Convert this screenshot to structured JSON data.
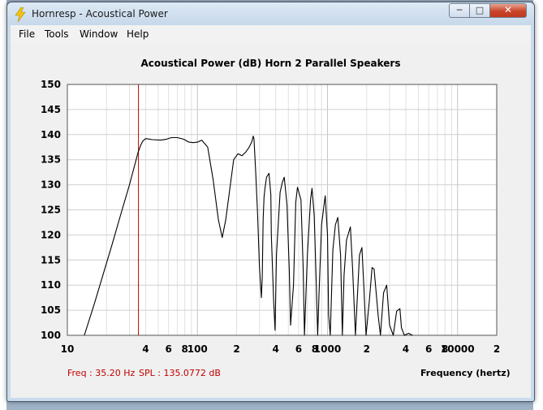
{
  "window": {
    "title": "Hornresp - Acoustical Power",
    "controls": {
      "minimize": "─",
      "maximize": "□",
      "close": "✕"
    }
  },
  "menu": [
    "File",
    "Tools",
    "Window",
    "Help"
  ],
  "chart_data": {
    "type": "line",
    "title": "Acoustical Power (dB)   Horn   2 Parallel Speakers",
    "xlabel": "Frequency (hertz)",
    "ylabel": "",
    "x_scale": "log",
    "xlim": [
      10,
      20000
    ],
    "ylim": [
      100,
      150
    ],
    "grid": true,
    "y_ticks": [
      "150",
      "145",
      "140",
      "135",
      "130",
      "125",
      "120",
      "115",
      "110",
      "105",
      "100"
    ],
    "x_ticks": [
      {
        "f": 10,
        "label": "10"
      },
      {
        "f": 40,
        "label": "4"
      },
      {
        "f": 60,
        "label": "6"
      },
      {
        "f": 80,
        "label": "8"
      },
      {
        "f": 100,
        "label": "100"
      },
      {
        "f": 200,
        "label": "2"
      },
      {
        "f": 400,
        "label": "4"
      },
      {
        "f": 600,
        "label": "6"
      },
      {
        "f": 800,
        "label": "8"
      },
      {
        "f": 1000,
        "label": "1000"
      },
      {
        "f": 2000,
        "label": "2"
      },
      {
        "f": 4000,
        "label": "4"
      },
      {
        "f": 6000,
        "label": "6"
      },
      {
        "f": 8000,
        "label": "8"
      },
      {
        "f": 10000,
        "label": "10000"
      },
      {
        "f": 20000,
        "label": "2"
      }
    ],
    "cursor": {
      "freq": 35.2,
      "color": "#c00000"
    },
    "series": [
      {
        "name": "",
        "color": "#000000",
        "x": [
          13.5,
          16,
          19,
          22,
          26,
          30,
          33,
          35,
          36.5,
          38,
          40,
          45,
          52,
          58,
          63,
          70,
          78,
          86,
          93,
          100,
          108,
          120,
          132,
          145,
          155,
          165,
          178,
          190,
          205,
          212,
          220,
          235,
          250,
          262,
          268,
          272,
          280,
          290,
          300,
          310,
          315,
          320,
          325,
          331,
          340,
          355,
          367,
          370,
          385,
          395,
          405,
          432,
          450,
          465,
          488,
          508,
          520,
          548,
          570,
          588,
          625,
          650,
          665,
          700,
          740,
          760,
          790,
          820,
          840,
          860,
          900,
          940,
          960,
          1000,
          1020,
          1050,
          1100,
          1150,
          1200,
          1260,
          1300,
          1340,
          1400,
          1500,
          1560,
          1640,
          1700,
          1760,
          1840,
          1900,
          1980,
          2100,
          2200,
          2280,
          2450,
          2550,
          2700,
          2850,
          3000,
          3200,
          3400,
          3600,
          3700,
          3900,
          4200,
          4500
        ],
        "y": [
          100,
          106,
          112.5,
          118,
          124.5,
          130,
          134,
          136.5,
          137.8,
          138.7,
          139.2,
          139,
          138.9,
          139.1,
          139.4,
          139.4,
          139.1,
          138.5,
          138.4,
          138.5,
          138.9,
          137.5,
          131,
          123,
          119.5,
          123,
          129.5,
          135,
          136.2,
          136,
          135.8,
          136.5,
          137.5,
          138.6,
          139.7,
          139.2,
          133,
          124,
          113.5,
          107.5,
          111.5,
          123,
          127.5,
          129.5,
          131.5,
          132.3,
          128,
          120,
          107,
          101,
          116,
          128.5,
          130.5,
          131.5,
          126,
          113,
          102,
          110,
          126.5,
          129.5,
          127,
          113.5,
          100,
          116,
          127,
          129.3,
          124,
          110,
          100,
          108,
          122,
          126,
          127.8,
          120,
          104,
          100,
          117,
          122,
          123.5,
          116,
          100,
          112,
          119,
          121.6,
          113,
          100,
          108,
          116,
          117.5,
          110,
          100,
          107,
          113.5,
          113.2,
          104,
          100,
          108.5,
          110,
          102,
          100,
          104.8,
          105.3,
          101.5,
          100,
          100.4,
          100
        ]
      }
    ],
    "readouts": {
      "freq": "Freq : 35.20 Hz",
      "spl": "SPL : 135.0772 dB"
    }
  }
}
